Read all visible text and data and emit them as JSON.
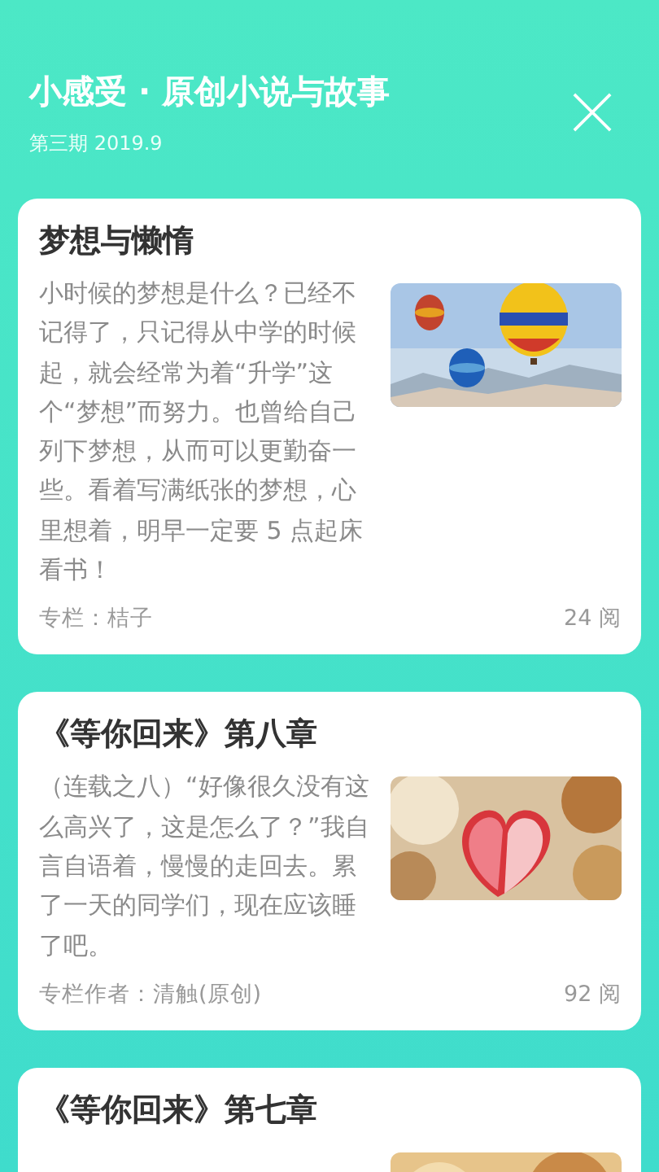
{
  "header": {
    "title": "小感受 · 原创小说与故事",
    "subtitle": "第三期 2019.9"
  },
  "articles": [
    {
      "title": "梦想与懒惰",
      "excerpt": "小时候的梦想是什么？已经不记得了，只记得从中学的时候起，就会经常为着“升学”这个“梦想”而努力。也曾给自己列下梦想，从而可以更勤奋一些。看着写满纸张的梦想，心里想着，明早一定要 5 点起床看书！",
      "column": "专栏：桔子",
      "reads": "24 阅"
    },
    {
      "title": "《等你回来》第八章",
      "excerpt": "（连载之八）“好像很久没有这么高兴了，这是怎么了？”我自言自语着，慢慢的走回去。累了一天的同学们，现在应该睡了吧。",
      "column": "专栏作者：清触(原创)",
      "reads": "92 阅"
    },
    {
      "title": "《等你回来》第七章"
    }
  ]
}
